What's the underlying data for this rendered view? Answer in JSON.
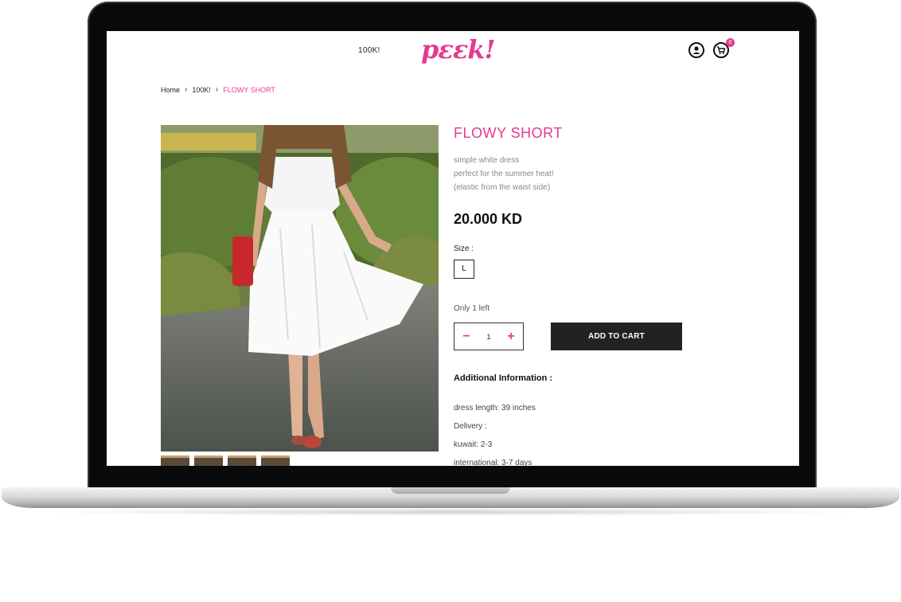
{
  "header": {
    "nav_link": "100K!",
    "logo_text": "pεεk!",
    "cart_count": "0"
  },
  "breadcrumb": {
    "home": "Home",
    "category": "100K!",
    "current": "FLOWY SHORT"
  },
  "product": {
    "title": "FLOWY SHORT",
    "description": [
      "simple white dress",
      "perfect for the summer heat!",
      "(elastic from the waist side)"
    ],
    "price": "20.000 KD",
    "size_label": "Size :",
    "size_option": "L",
    "stock_note": "Only 1 left",
    "quantity": "1",
    "add_to_cart_label": "ADD TO CART",
    "additional_title": "Additional Information :",
    "additional_info": [
      "dress length: 39 inches",
      "Delivery :",
      "kuwait: 2-3",
      "international: 3-7 days"
    ],
    "thumbnail_count": 4
  },
  "colors": {
    "accent": "#e33b92",
    "button_bg": "#222222"
  }
}
